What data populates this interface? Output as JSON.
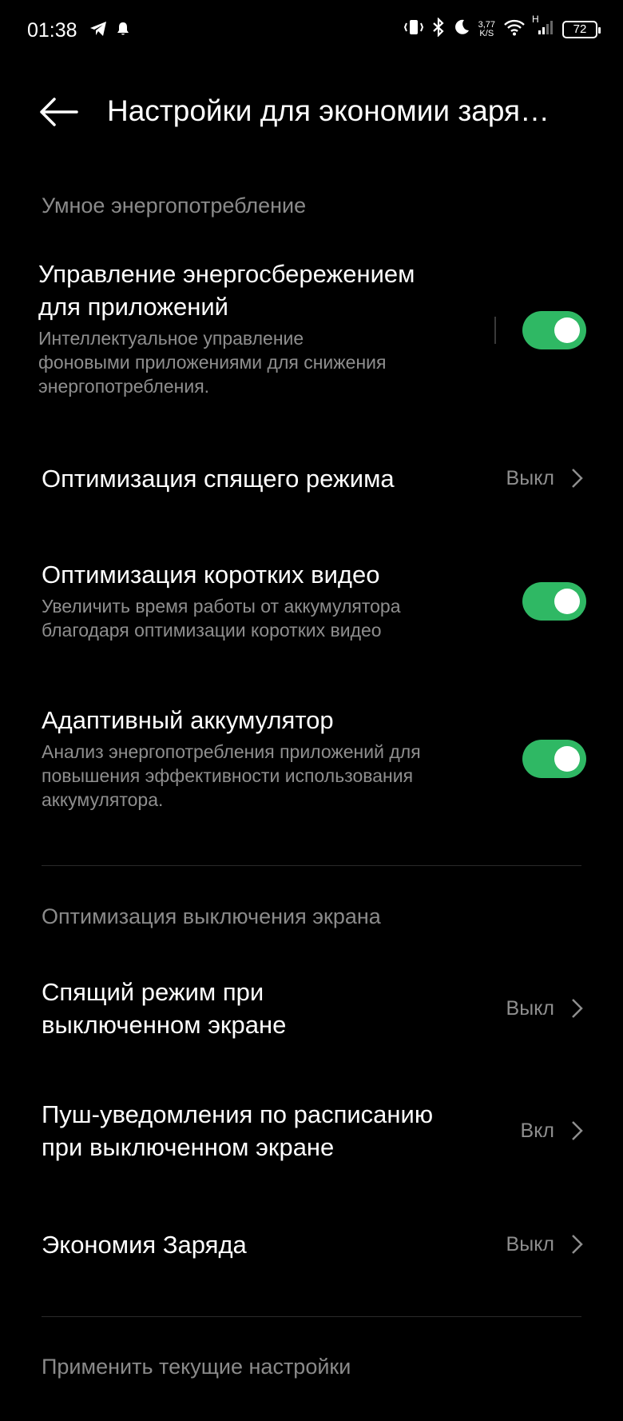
{
  "status_bar": {
    "time": "01:38",
    "net_speed_value": "3,77",
    "net_speed_unit": "K/S",
    "signal_label": "H",
    "battery": "72"
  },
  "header": {
    "title": "Настройки для экономии заря…"
  },
  "sections": {
    "smart": "Умное энергопотребление",
    "screen_off": "Оптимизация выключения экрана",
    "apply": "Применить текущие настройки"
  },
  "items": {
    "app_power": {
      "title_line1": "Управление энергосбережением",
      "title_line2": "для приложений",
      "sub_line1": "Интеллектуальное управление",
      "sub_line2": "фоновыми приложениями для снижения",
      "sub_line3": "энергопотребления.",
      "enabled": true
    },
    "sleep_opt": {
      "title": "Оптимизация спящего режима",
      "value": "Выкл"
    },
    "short_video": {
      "title": "Оптимизация коротких видео",
      "sub_line1": "Увеличить время работы от аккумулятора",
      "sub_line2": "благодаря оптимизации коротких видео",
      "enabled": true
    },
    "adaptive": {
      "title": "Адаптивный аккумулятор",
      "sub_line1": "Анализ энергопотребления приложений для",
      "sub_line2": "повышения эффективности использования",
      "sub_line3": "аккумулятора.",
      "enabled": true
    },
    "sleep_screen_off": {
      "title_line1": "Спящий режим при",
      "title_line2": "выключенном экране",
      "value": "Выкл"
    },
    "push_schedule": {
      "title_line1": "Пуш-уведомления по расписанию",
      "title_line2": "при выключенном экране",
      "value": "Вкл"
    },
    "power_saving": {
      "title": "Экономия Заряда",
      "value": "Выкл"
    }
  },
  "colors": {
    "toggle_on": "#2fb864",
    "background": "#000000",
    "secondary_text": "#8e8e8e"
  }
}
